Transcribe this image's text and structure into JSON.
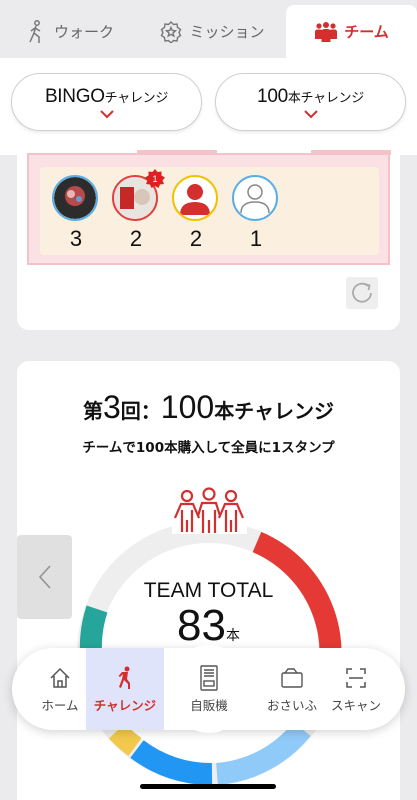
{
  "tabs": [
    {
      "label": "ウォーク",
      "icon": "walker-icon"
    },
    {
      "label": "ミッション",
      "icon": "star-badge-icon"
    },
    {
      "label": "チーム",
      "icon": "team-icon",
      "active": true
    }
  ],
  "challenges": {
    "bingo": {
      "label_main": "BINGO",
      "label_sub": "チャレンジ"
    },
    "hundred": {
      "label_main": "100",
      "label_sub": "本チャレンジ"
    }
  },
  "members": [
    {
      "count": "3",
      "ring": "#5aaee6",
      "kind": "photo-dark"
    },
    {
      "count": "2",
      "ring": "#e04040",
      "kind": "photo-red",
      "badge": "1"
    },
    {
      "count": "2",
      "ring": "#f2c200",
      "kind": "person-red"
    },
    {
      "count": "1",
      "ring": "#5aaee6",
      "kind": "person-outline"
    }
  ],
  "challenge_card": {
    "title_prefix": "第",
    "round": "3",
    "round_suffix": "回：",
    "target": "100",
    "title_suffix": "本チャレンジ",
    "subtitle": "チームで100本購入して全員に1スタンプ",
    "team_total_label": "TEAM TOTAL",
    "team_total_value": "83",
    "team_total_unit": "本",
    "progress": 0.83
  },
  "bottom_nav": [
    {
      "label": "ホーム",
      "icon": "home-icon"
    },
    {
      "label": "チャレンジ",
      "icon": "runner-icon",
      "active": true
    },
    {
      "label": "自販機",
      "icon": "vending-machine-icon"
    },
    {
      "label": "おさいふ",
      "icon": "wallet-icon"
    },
    {
      "label": "スキャン",
      "icon": "scan-icon"
    }
  ],
  "colors": {
    "accent": "#d32f2f",
    "ring_red": "#e53935",
    "ring_track": "#eeeeee"
  }
}
